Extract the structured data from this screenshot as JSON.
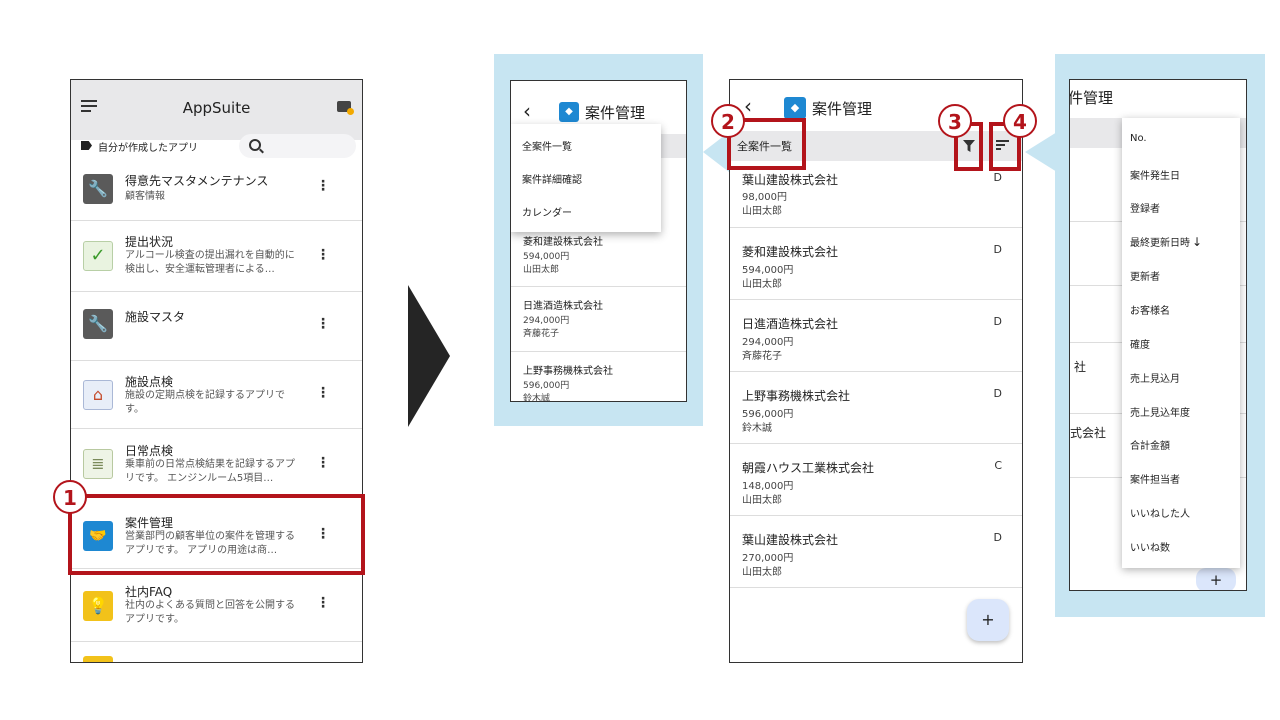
{
  "app_list": {
    "header_title": "AppSuite",
    "filter_label": "自分が作成したアプリ",
    "apps": [
      {
        "title": "得意先マスタメンテナンス",
        "desc": "顧客情報"
      },
      {
        "title": "提出状況",
        "desc": "アルコール検査の提出漏れを自動的に検出し、安全運転管理者による…"
      },
      {
        "title": "施設マスタ",
        "desc": ""
      },
      {
        "title": "施設点検",
        "desc": "施設の定期点検を記録するアプリです。"
      },
      {
        "title": "日常点検",
        "desc": "乗車前の日常点検結果を記録するアプリです。 エンジンルーム5項目…"
      },
      {
        "title": "案件管理",
        "desc": "営業部門の顧客単位の案件を管理するアプリです。 アプリの用途は商…"
      },
      {
        "title": "社内FAQ",
        "desc": "社内のよくある質問と回答を公開するアプリです。"
      }
    ]
  },
  "view_menu": {
    "title": "案件管理",
    "items": [
      "全案件一覧",
      "案件詳細確認",
      "カレンダー"
    ],
    "cases": [
      {
        "name": "菱和建設株式会社",
        "amount": "594,000円",
        "person": "山田太郎"
      },
      {
        "name": "日進酒造株式会社",
        "amount": "294,000円",
        "person": "斉藤花子"
      },
      {
        "name": "上野事務機株式会社",
        "amount": "596,000円",
        "person": "鈴木誠"
      }
    ]
  },
  "case_list": {
    "title": "案件管理",
    "view_label": "全案件一覧",
    "add_label": "+",
    "cases": [
      {
        "name": "葉山建設株式会社",
        "amount": "98,000円",
        "person": "山田太郎",
        "rank": "D"
      },
      {
        "name": "菱和建設株式会社",
        "amount": "594,000円",
        "person": "山田太郎",
        "rank": "D"
      },
      {
        "name": "日進酒造株式会社",
        "amount": "294,000円",
        "person": "斉藤花子",
        "rank": "D"
      },
      {
        "name": "上野事務機株式会社",
        "amount": "596,000円",
        "person": "鈴木誠",
        "rank": "D"
      },
      {
        "name": "朝霞ハウス工業株式会社",
        "amount": "148,000円",
        "person": "山田太郎",
        "rank": "C"
      },
      {
        "name": "葉山建設株式会社",
        "amount": "270,000円",
        "person": "山田太郎",
        "rank": "D"
      }
    ]
  },
  "sort_menu": {
    "title_fragment": "件管理",
    "items": [
      "No.",
      "案件発生日",
      "登録者",
      "最終更新日時",
      "更新者",
      "お客様名",
      "確度",
      "売上見込月",
      "売上見込年度",
      "合計金額",
      "案件担当者",
      "いいねした人",
      "いいね数"
    ],
    "behind_fragments": [
      "社",
      "式会社"
    ],
    "add_label": "+"
  },
  "callouts": [
    "1",
    "2",
    "3",
    "4"
  ],
  "colors": {
    "accent_red": "#b3141b",
    "panel_blue": "#c7e5f2",
    "header_grey": "#e8e8ea"
  }
}
